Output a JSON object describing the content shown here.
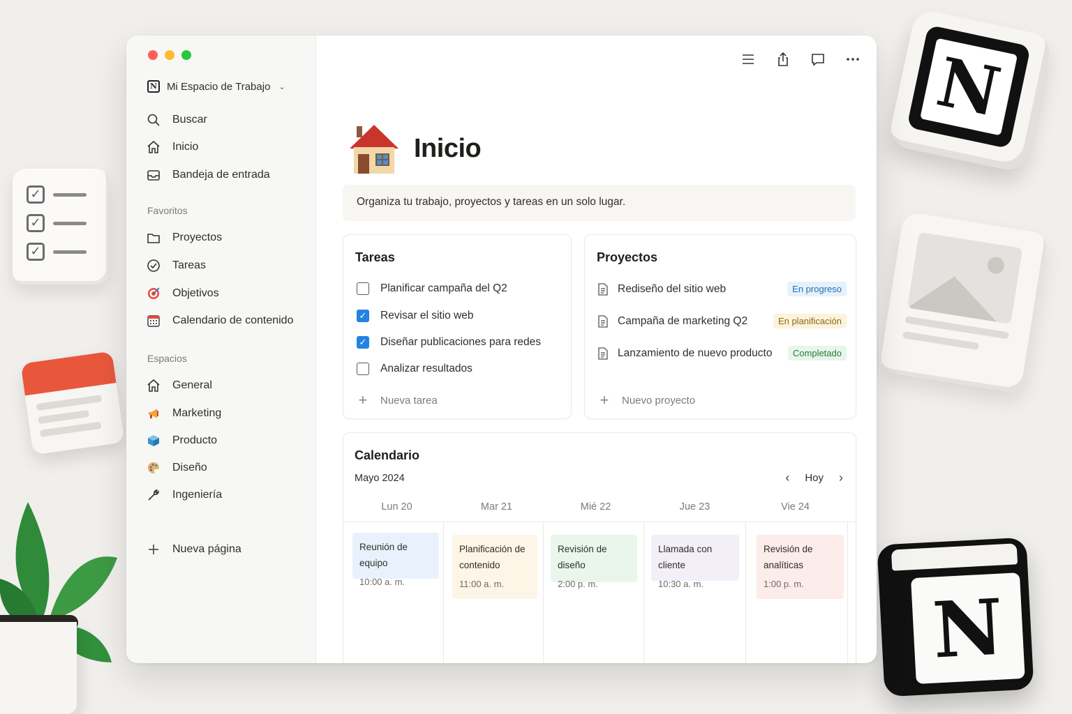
{
  "sidebar": {
    "workspace_name": "Mi Espacio de Trabajo",
    "nav": [
      {
        "label": "Buscar",
        "icon": "search-icon"
      },
      {
        "label": "Inicio",
        "icon": "home-icon"
      },
      {
        "label": "Bandeja de entrada",
        "icon": "inbox-icon"
      }
    ],
    "favorites_label": "Favoritos",
    "favorites": [
      {
        "label": "Proyectos",
        "icon": "folder-icon"
      },
      {
        "label": "Tareas",
        "icon": "check-circle-icon"
      },
      {
        "label": "Objetivos",
        "icon": "target-icon"
      },
      {
        "label": "Calendario de contenido",
        "icon": "calendar-icon"
      }
    ],
    "spaces_label": "Espacios",
    "spaces": [
      {
        "label": "General",
        "icon": "home-icon"
      },
      {
        "label": "Marketing",
        "icon": "megaphone-icon"
      },
      {
        "label": "Producto",
        "icon": "cube-icon"
      },
      {
        "label": "Diseño",
        "icon": "palette-icon"
      },
      {
        "label": "Ingeniería",
        "icon": "wrench-icon"
      }
    ],
    "new_page_label": "Nueva página"
  },
  "page": {
    "title": "Inicio",
    "description": "Organiza tu trabajo, proyectos y tareas en un solo lugar."
  },
  "tasks": {
    "title": "Tareas",
    "items": [
      {
        "label": "Planificar campaña del Q2",
        "checked": false
      },
      {
        "label": "Revisar el sitio web",
        "checked": true
      },
      {
        "label": "Diseñar publicaciones para redes",
        "checked": true
      },
      {
        "label": "Analizar resultados",
        "checked": false
      }
    ],
    "add_label": "Nueva tarea"
  },
  "projects": {
    "title": "Proyectos",
    "items": [
      {
        "label": "Rediseño del sitio web",
        "status": "En progreso",
        "status_color": "#1f6fb5"
      },
      {
        "label": "Campaña de marketing Q2",
        "status": "En planificación",
        "status_color": "#8a6a12"
      },
      {
        "label": "Lanzamiento de nuevo producto",
        "status": "Completado",
        "status_color": "#2c7a3c"
      }
    ],
    "add_label": "Nuevo proyecto"
  },
  "calendar": {
    "title": "Calendario",
    "month": "Mayo 2024",
    "today_label": "Hoy",
    "days": [
      "Lun 20",
      "Mar 21",
      "Mié 22",
      "Jue 23",
      "Vie 24"
    ],
    "events": [
      {
        "title": "Reunión de equipo",
        "time": "10:00 a. m.",
        "color": "#e9f2fc"
      },
      {
        "title": "Planificación de contenido",
        "time": "11:00 a. m.",
        "color": "#fdf6e6"
      },
      {
        "title": "Revisión de diseño",
        "time": "2:00 p. m.",
        "color": "#eaf6ec"
      },
      {
        "title": "Llamada con cliente",
        "time": "10:30 a. m.",
        "color": "#f2eff9"
      },
      {
        "title": "Revisión de analíticas",
        "time": "1:00 p. m.",
        "color": "#fcecea"
      }
    ]
  },
  "colors": {
    "accent": "#2383e2",
    "traffic_red": "#ff5f57",
    "traffic_yellow": "#febc2e",
    "traffic_green": "#28c840"
  },
  "decor": {
    "logo_letter": "N"
  }
}
